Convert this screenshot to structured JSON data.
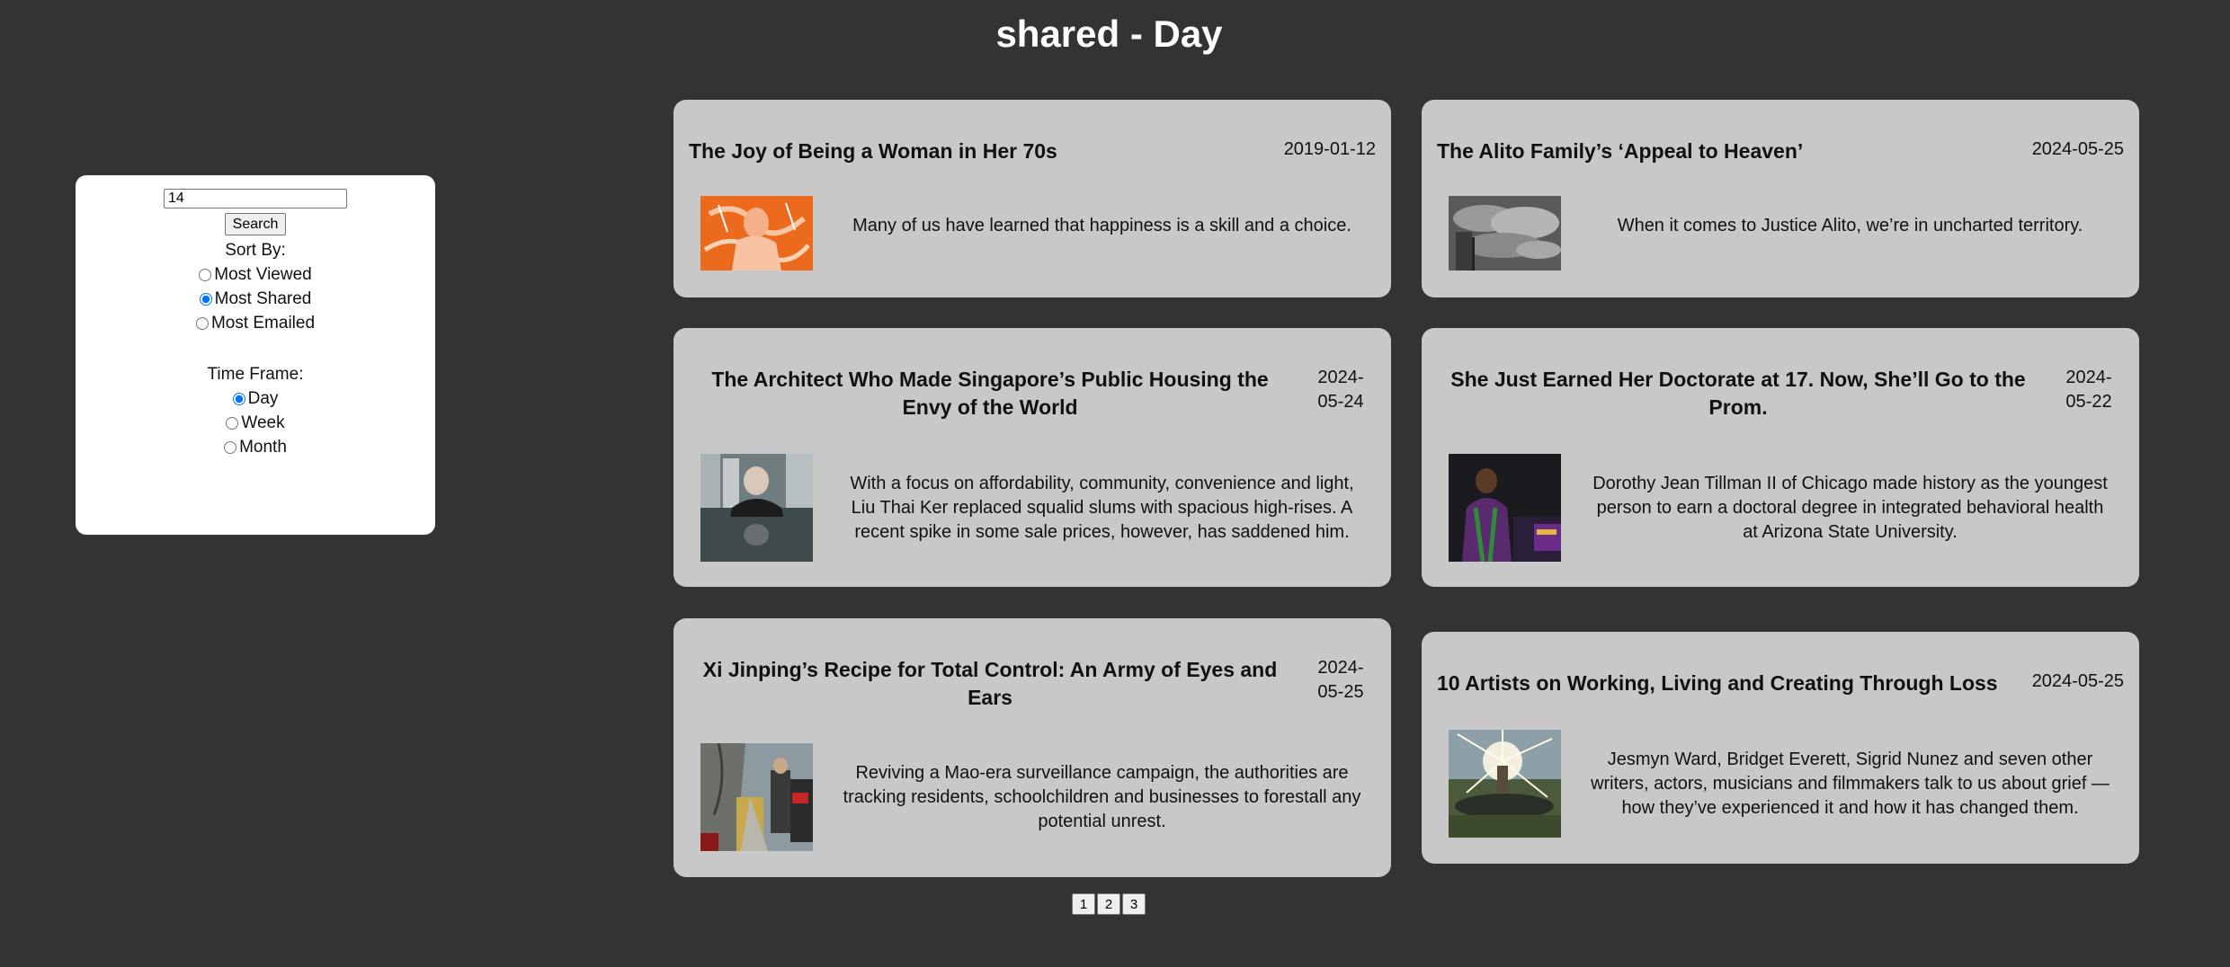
{
  "page": {
    "title": "shared - Day"
  },
  "search": {
    "value": "14",
    "button_label": "Search"
  },
  "sort": {
    "label": "Sort By:",
    "options": [
      "Most Viewed",
      "Most Shared",
      "Most Emailed"
    ],
    "selected": "Most Shared"
  },
  "timeframe": {
    "label": "Time Frame:",
    "options": [
      "Day",
      "Week",
      "Month"
    ],
    "selected": "Day"
  },
  "articles": [
    {
      "title": "The Joy of Being a Woman in Her 70s",
      "date": "2019-01-12",
      "abstract": "Many of us have learned that happiness is a skill and a choice.",
      "image": "illustration-woman-orange"
    },
    {
      "title": "The Alito Family’s ‘Appeal to Heaven’",
      "date": "2024-05-25",
      "abstract": "When it comes to Justice Alito, we’re in uncharted territory.",
      "image": "clouds-flag-photo"
    },
    {
      "title": "The Architect Who Made Singapore’s Public Housing the Envy of the World",
      "date": "2024-05-24",
      "abstract": "With a focus on affordability, community, convenience and light, Liu Thai Ker replaced squalid slums with spacious high-rises. A recent spike in some sale prices, however, has saddened him.",
      "image": "architect-portrait-photo"
    },
    {
      "title": "She Just Earned Her Doctorate at 17. Now, She’ll Go to the Prom.",
      "date": "2024-05-22",
      "abstract": "Dorothy Jean Tillman II of Chicago made history as the youngest person to earn a doctoral degree in integrated behavioral health at Arizona State University.",
      "image": "graduate-podium-photo"
    },
    {
      "title": "Xi Jinping’s Recipe for Total Control: An Army of Eyes and Ears",
      "date": "2024-05-25",
      "abstract": "Reviving a Mao-era surveillance campaign, the authorities are tracking residents, schoolchildren and businesses to forestall any potential unrest.",
      "image": "street-guards-photo"
    },
    {
      "title": "10 Artists on Working, Living and Creating Through Loss",
      "date": "2024-05-25",
      "abstract": "Jesmyn Ward, Bridget Everett, Sigrid Nunez and seven other writers, actors, musicians and filmmakers talk to us about grief — how they’ve experienced it and how it has changed them.",
      "image": "trampoline-sunlight-photo"
    }
  ],
  "pagination": {
    "pages": [
      "1",
      "2",
      "3"
    ]
  },
  "colors": {
    "background": "#333333",
    "card": "#c8c8c8",
    "panel": "#ffffff",
    "accent": "#1a73e8"
  }
}
